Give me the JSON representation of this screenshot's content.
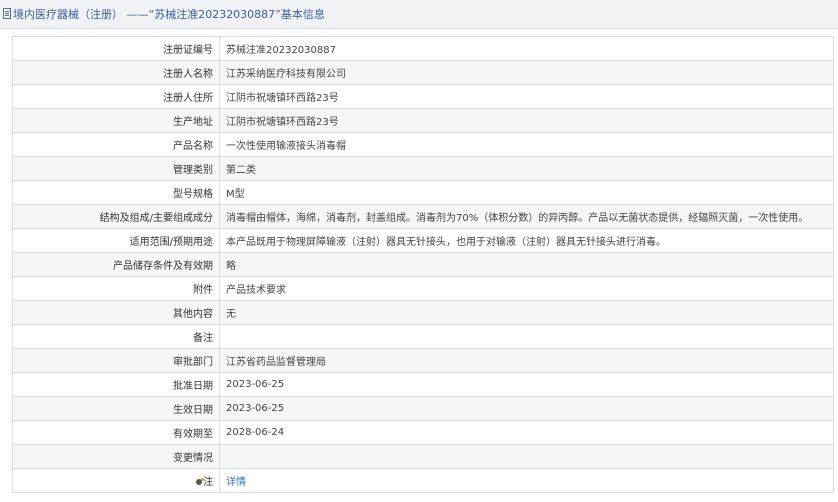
{
  "header": {
    "icon": "document-icon",
    "title": "境内医疗器械（注册） ——“苏械注准20232030887”基本信息"
  },
  "rows": [
    {
      "label": "注册证编号",
      "value": "苏械注准20232030887"
    },
    {
      "label": "注册人名称",
      "value": "江苏采纳医疗科技有限公司"
    },
    {
      "label": "注册人住所",
      "value": "江阴市祝塘镇环西路23号"
    },
    {
      "label": "生产地址",
      "value": "江阴市祝塘镇环西路23号"
    },
    {
      "label": "产品名称",
      "value": "一次性使用输液接头消毒帽"
    },
    {
      "label": "管理类别",
      "value": "第二类"
    },
    {
      "label": "型号规格",
      "value": "M型"
    },
    {
      "label": "结构及组成/主要组成成分",
      "value": "消毒帽由帽体，海绵，消毒剂，封盖组成。消毒剂为70%（体积分数）的异丙醇。产品以无菌状态提供，经辐照灭菌，一次性使用。"
    },
    {
      "label": "适用范围/预期用途",
      "value": "本产品既用于物理屏障输液（注射）器具无针接头，也用于对输液（注射）器具无针接头进行消毒。"
    },
    {
      "label": "产品储存条件及有效期",
      "value": "略"
    },
    {
      "label": "附件",
      "value": "产品技术要求"
    },
    {
      "label": "其他内容",
      "value": "无"
    },
    {
      "label": "备注",
      "value": ""
    },
    {
      "label": "审批部门",
      "value": "江苏省药品监督管理局"
    },
    {
      "label": "批准日期",
      "value": "2023-06-25"
    },
    {
      "label": "生效日期",
      "value": "2023-06-25"
    },
    {
      "label": "有效期至",
      "value": "2028-06-24"
    },
    {
      "label": "变更情况",
      "value": ""
    }
  ],
  "note_row": {
    "icon": "note-icon",
    "label": "注",
    "link_text": "详情"
  },
  "colors": {
    "header_bg": "#f0f2f6",
    "header_text": "#3a5ea0",
    "link": "#2f6fd6",
    "stripe": "#f6f6f6",
    "border": "#dcdcdc"
  }
}
